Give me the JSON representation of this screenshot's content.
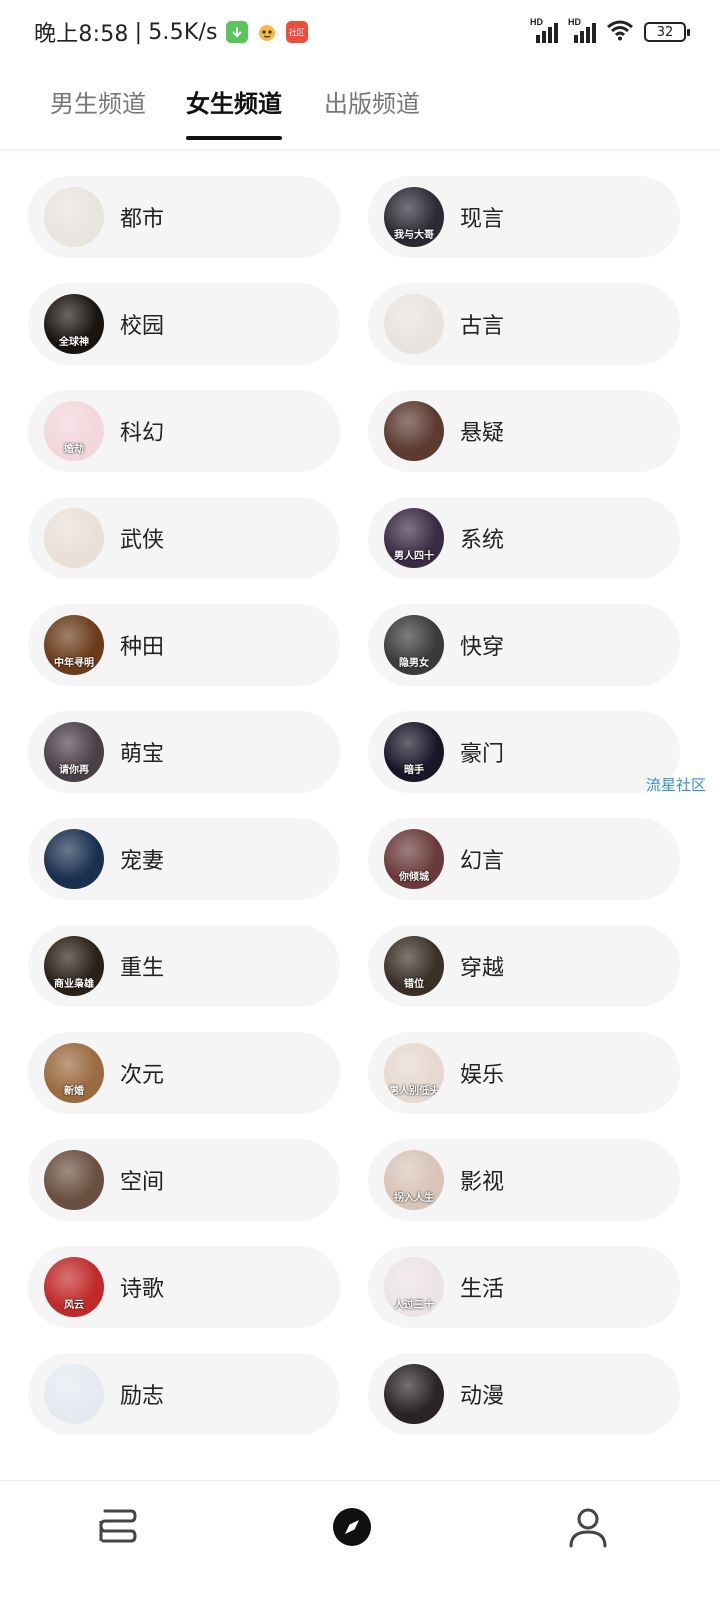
{
  "status_bar": {
    "time": "晚上8:58",
    "speed": "5.5K/s",
    "separator": "|",
    "badge_red_text": "社区",
    "network_label_1": "HD",
    "network_label_2": "HD",
    "battery": "32"
  },
  "tabs": [
    {
      "label": "男生频道"
    },
    {
      "label": "女生频道"
    },
    {
      "label": "出版频道"
    }
  ],
  "active_tab": "女生频道",
  "categories": [
    {
      "label": "都市",
      "cover_text": "",
      "cover_color": "#e8e4de"
    },
    {
      "label": "现言",
      "cover_text": "我与大哥",
      "cover_color": "#2a2a34"
    },
    {
      "label": "校园",
      "cover_text": "全球神",
      "cover_color": "#1a1410"
    },
    {
      "label": "古言",
      "cover_text": "",
      "cover_color": "#e9e3df"
    },
    {
      "label": "科幻",
      "cover_text": "婚劫",
      "cover_color": "#f2d6dc"
    },
    {
      "label": "悬疑",
      "cover_text": "",
      "cover_color": "#5b3a30"
    },
    {
      "label": "武侠",
      "cover_text": "",
      "cover_color": "#e9e0d8"
    },
    {
      "label": "系统",
      "cover_text": "男人四十",
      "cover_color": "#3a2a44"
    },
    {
      "label": "种田",
      "cover_text": "中年寻明",
      "cover_color": "#6a3c1a"
    },
    {
      "label": "快穿",
      "cover_text": "隐男女",
      "cover_color": "#3a3a3c"
    },
    {
      "label": "萌宝",
      "cover_text": "请你再",
      "cover_color": "#4a4048"
    },
    {
      "label": "豪门",
      "cover_text": "暗手",
      "cover_color": "#1a1628"
    },
    {
      "label": "宠妻",
      "cover_text": "",
      "cover_color": "#1a3050"
    },
    {
      "label": "幻言",
      "cover_text": "你倾城",
      "cover_color": "#6a3a3a"
    },
    {
      "label": "重生",
      "cover_text": "商业枭雄",
      "cover_color": "#2a2016"
    },
    {
      "label": "穿越",
      "cover_text": "错位",
      "cover_color": "#3a3026"
    },
    {
      "label": "次元",
      "cover_text": "新婚",
      "cover_color": "#9a6a40"
    },
    {
      "label": "娱乐",
      "cover_text": "男人别低头",
      "cover_color": "#e6d8d0"
    },
    {
      "label": "空间",
      "cover_text": "",
      "cover_color": "#6a5040"
    },
    {
      "label": "影视",
      "cover_text": "拐入人生",
      "cover_color": "#d8c4b8"
    },
    {
      "label": "诗歌",
      "cover_text": "风云",
      "cover_color": "#c02a2a"
    },
    {
      "label": "生活",
      "cover_text": "人过三十",
      "cover_color": "#ece4e4"
    },
    {
      "label": "励志",
      "cover_text": "",
      "cover_color": "#e4eaf0"
    },
    {
      "label": "动漫",
      "cover_text": "",
      "cover_color": "#2a2424"
    }
  ],
  "watermark": "流星社区",
  "bottom_nav": [
    {
      "icon": "bookshelf-icon",
      "active": false
    },
    {
      "icon": "compass-icon",
      "active": true
    },
    {
      "icon": "profile-icon",
      "active": false
    }
  ]
}
